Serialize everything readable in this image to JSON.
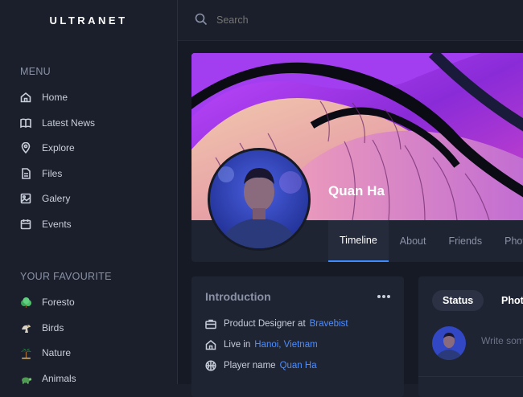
{
  "app": {
    "logo": "ULTRANET"
  },
  "search": {
    "placeholder": "Search"
  },
  "sidebar": {
    "menu_title": "MENU",
    "menu": [
      {
        "label": "Home",
        "icon": "home-icon"
      },
      {
        "label": "Latest News",
        "icon": "book-icon"
      },
      {
        "label": "Explore",
        "icon": "location-pin-icon"
      },
      {
        "label": "Files",
        "icon": "file-icon"
      },
      {
        "label": "Galery",
        "icon": "image-icon"
      },
      {
        "label": "Events",
        "icon": "calendar-icon"
      }
    ],
    "favourite_title": "YOUR FAVOURITE",
    "favourites": [
      {
        "label": "Foresto",
        "icon": "bush-icon"
      },
      {
        "label": "Birds",
        "icon": "eagle-icon"
      },
      {
        "label": "Nature",
        "icon": "palm-tree-icon"
      },
      {
        "label": "Animals",
        "icon": "turtle-icon"
      }
    ]
  },
  "profile": {
    "name": "Quan Ha",
    "tabs": [
      "Timeline",
      "About",
      "Friends",
      "Photos"
    ],
    "active_tab": "Timeline"
  },
  "intro": {
    "title": "Introduction",
    "job_prefix": "Product Designer at",
    "job_company": "Bravebist",
    "location_prefix": "Live in",
    "location": "Hanoi, Vietnam",
    "player_prefix": "Player name",
    "player_name": "Quan Ha"
  },
  "composer": {
    "tab_status": "Status",
    "tab_photo": "Photo",
    "placeholder": "Write something"
  },
  "colors": {
    "accent": "#3f8cff",
    "link": "#4d8dff",
    "sidebar_bg": "#1b1f2c",
    "card_bg": "#1f2433"
  }
}
